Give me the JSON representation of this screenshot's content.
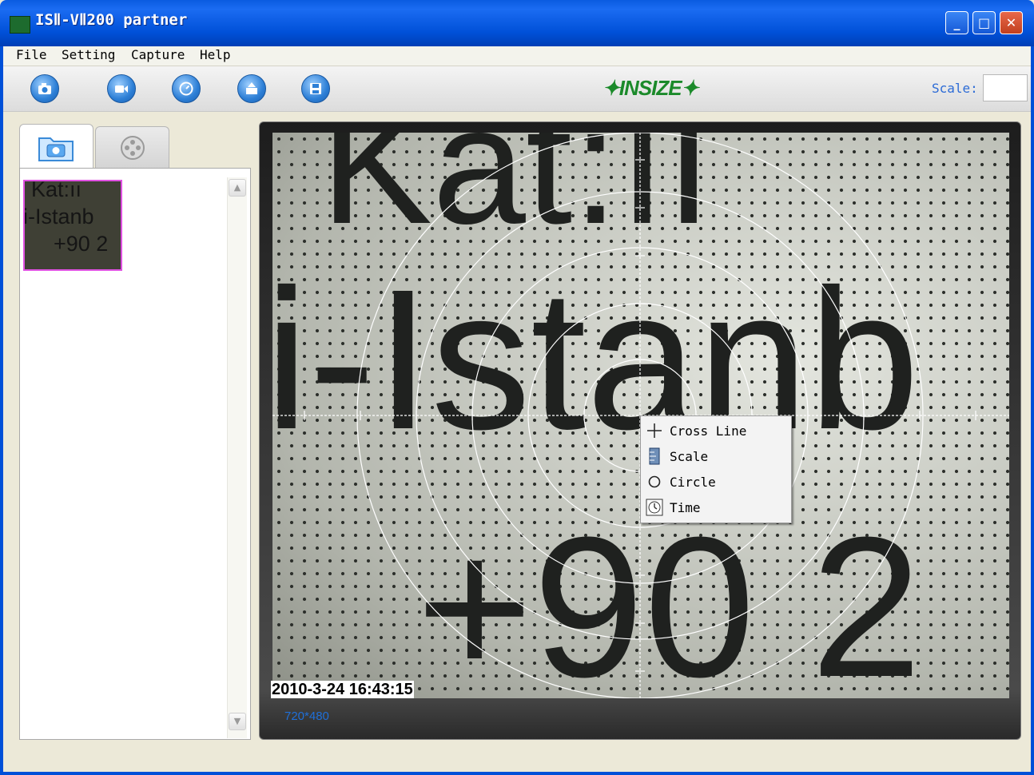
{
  "window": {
    "title": "ISⅡ-VⅡ200 partner",
    "min_glyph": "_",
    "max_glyph": "□",
    "close_glyph": "✕"
  },
  "menu": {
    "items": [
      "File",
      "Setting",
      "Capture",
      "Help"
    ]
  },
  "toolbar": {
    "buttons": [
      "camera-capture",
      "video-record",
      "timer",
      "export",
      "save"
    ],
    "logo": "✦INSIZE✦",
    "scale_label": "Scale:",
    "scale_value": ""
  },
  "left_panel": {
    "tabs": [
      "photos",
      "video-reel"
    ],
    "thumbnail_lines": [
      "Kat:ıı",
      "i-Istanb",
      "+90 2"
    ]
  },
  "video": {
    "text_lines": [
      "Kat:II",
      "i-Istanb",
      "+90 2"
    ],
    "timestamp": "2010-3-24 16:43:15",
    "resolution": "720*480"
  },
  "context_menu": {
    "items": [
      {
        "label": "Cross Line",
        "icon": "crosshair-icon"
      },
      {
        "label": "Scale",
        "icon": "ruler-icon"
      },
      {
        "label": "Circle",
        "icon": "circle-icon"
      },
      {
        "label": "Time",
        "icon": "clock-icon"
      }
    ]
  },
  "colors": {
    "titlebar": "#0050d8",
    "accent": "#2c6bd6",
    "logo": "#1b8a2a",
    "thumb_border": "#e051e2"
  }
}
